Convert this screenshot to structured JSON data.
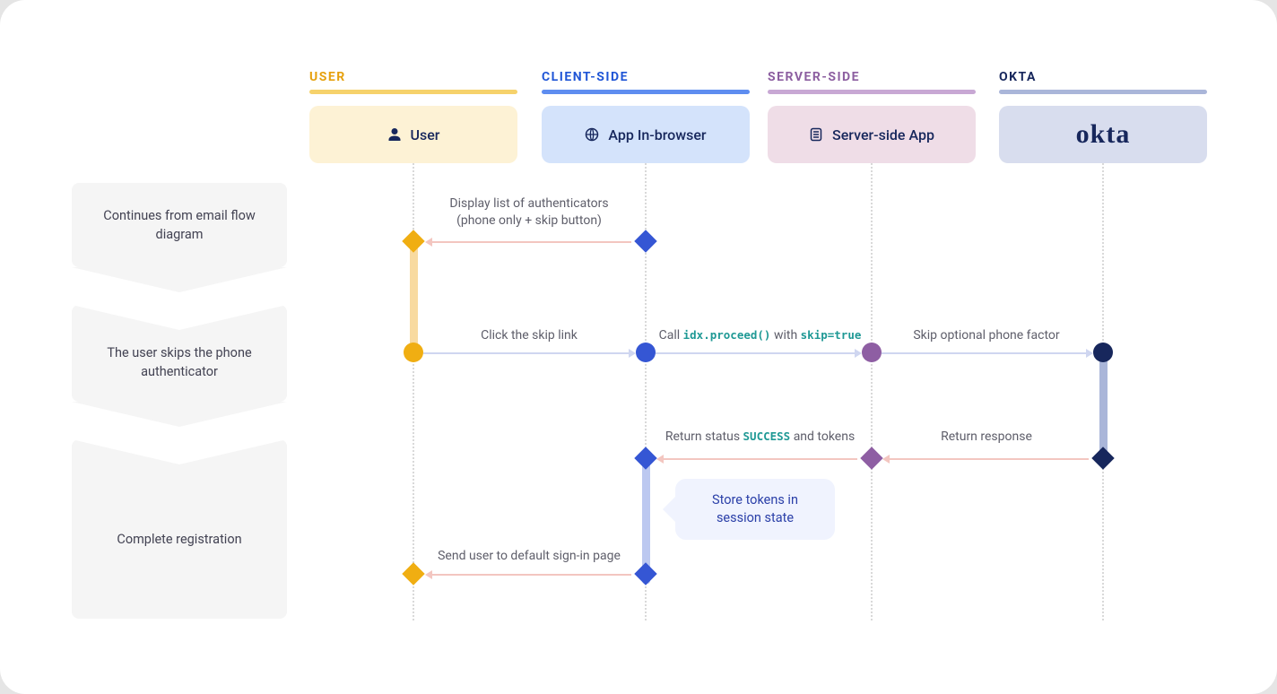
{
  "lanes": {
    "user": {
      "title": "USER",
      "card": "User",
      "colors": {
        "title": "#e6a00c",
        "underline": "#f6d26b",
        "cardBg": "#fdf2d5",
        "cardFg": "#17275c"
      }
    },
    "client": {
      "title": "CLIENT-SIDE",
      "card": "App In-browser",
      "colors": {
        "title": "#1f55d6",
        "underline": "#5e8df0",
        "cardBg": "#d4e3fb",
        "cardFg": "#17275c"
      }
    },
    "server": {
      "title": "SERVER-SIDE",
      "card": "Server-side App",
      "colors": {
        "title": "#8c5ea0",
        "underline": "#c8a8d4",
        "cardBg": "#efdde7",
        "cardFg": "#17275c"
      }
    },
    "okta": {
      "title": "OKTA",
      "card": "okta",
      "colors": {
        "title": "#17275c",
        "underline": "#aab6d9",
        "cardBg": "#d8ddee",
        "cardFg": "#17275c"
      }
    }
  },
  "steps": {
    "s1": "Continues from email flow diagram",
    "s2": "The user skips the phone authenticator",
    "s3": "Complete registration"
  },
  "messages": {
    "m1": {
      "line1": "Display list of authenticators",
      "line2": "(phone only + skip button)"
    },
    "m2": "Click the skip link",
    "m3": {
      "pre": "Call ",
      "code": "idx.proceed()",
      "mid": " with ",
      "code2": "skip=true"
    },
    "m4": "Skip optional phone factor",
    "m5": {
      "pre": "Return status ",
      "code": "SUCCESS",
      "post": " and tokens"
    },
    "m6": "Return response",
    "m7": "Send user to default sign-in page"
  },
  "callout": "Store tokens in session state",
  "colors": {
    "user": "#f0ae12",
    "client": "#3556d4",
    "server": "#8e5ea3",
    "okta": "#17275c",
    "userSeg": "#f8daa0",
    "clientSeg": "#bcc8f0",
    "oktaSeg": "#aab6d9",
    "respLine": "#f3c6c0",
    "reqLine": "#cfd6f0"
  },
  "layout": {
    "laneX": {
      "user": 345,
      "client": 604,
      "server": 856,
      "okta": 1114
    },
    "laneW": 232,
    "centerX": {
      "user": 461,
      "client": 720,
      "server": 972,
      "okta": 1230
    }
  }
}
